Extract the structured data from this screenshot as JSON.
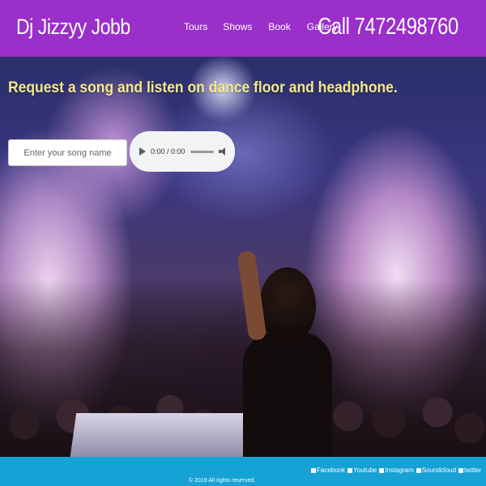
{
  "header": {
    "brand": "Dj Jizzyy Jobb",
    "nav": {
      "tours": "Tours",
      "shows": "Shows",
      "book": "Book",
      "gallery": "Gallery"
    },
    "call": "Call 7472498760",
    "color": "#9a2fc9"
  },
  "hero": {
    "title": "Request a song and listen on dance floor and headphone.",
    "song_input_placeholder": "Enter your song name",
    "player": {
      "time": "0:00 / 0:00",
      "progress": 0
    }
  },
  "footer": {
    "color": "#16a2d4",
    "social": {
      "facebook": "Facebook",
      "youtube": "Youtube",
      "instagram": "Instagram",
      "soundcloud": "Soundcloud",
      "twitter": "twitter"
    },
    "copyright": "© 2019 All rights reserved."
  }
}
